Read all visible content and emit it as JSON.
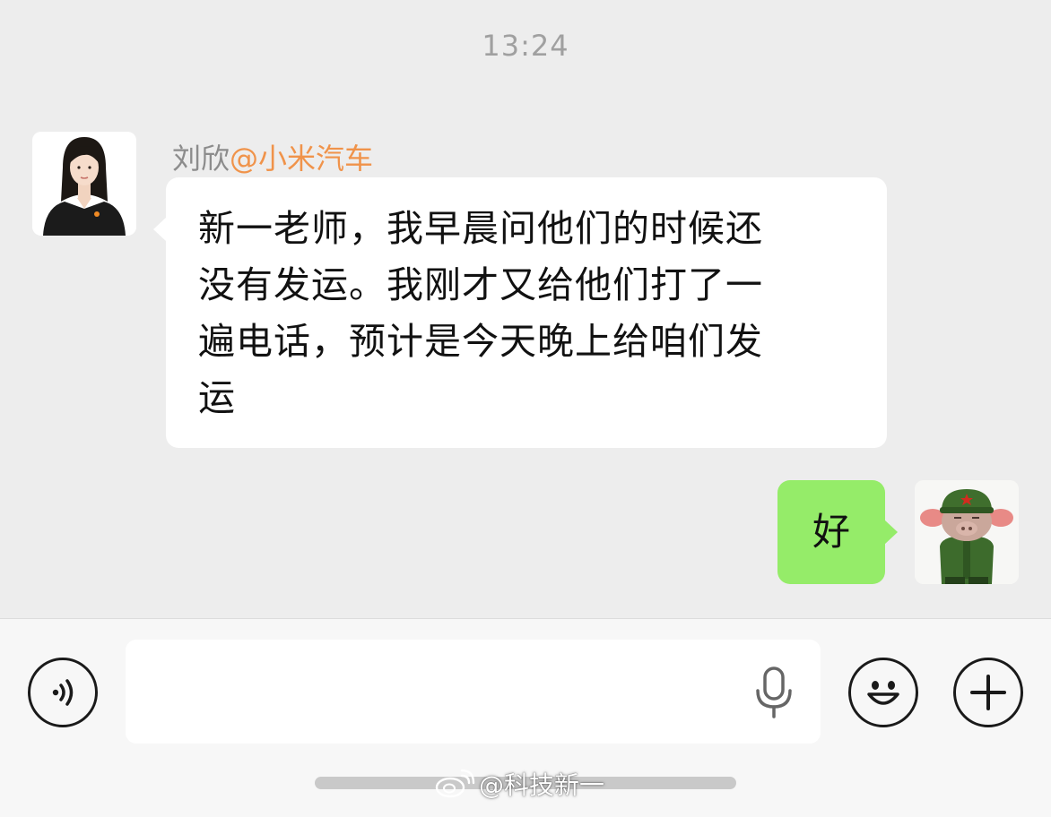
{
  "timestamp": "13:24",
  "incoming": {
    "sender_name": "刘欣",
    "sender_org": "@小米汽车",
    "avatar": "woman-portrait-avatar",
    "lines": [
      "新一老师，我早晨问他们的时候还",
      "没有发运。我刚才又给他们打了一",
      "遍电话，预计是今天晚上给咱们发",
      "运"
    ]
  },
  "outgoing": {
    "text": "好",
    "avatar": "cartoon-soldier-pig-avatar"
  },
  "input_bar": {
    "placeholder": "",
    "voice_icon": "voice-toggle-icon",
    "mic_icon": "microphone-icon",
    "emoji_icon": "smiley-emoji-icon",
    "plus_icon": "plus-icon"
  },
  "watermark": {
    "text": "@科技新一",
    "icon": "weibo-logo-icon"
  },
  "colors": {
    "background": "#ededed",
    "incoming_bubble": "#ffffff",
    "outgoing_bubble": "#95ec69",
    "sender_org": "#f0934a",
    "sender_name": "#8c8c8c"
  }
}
